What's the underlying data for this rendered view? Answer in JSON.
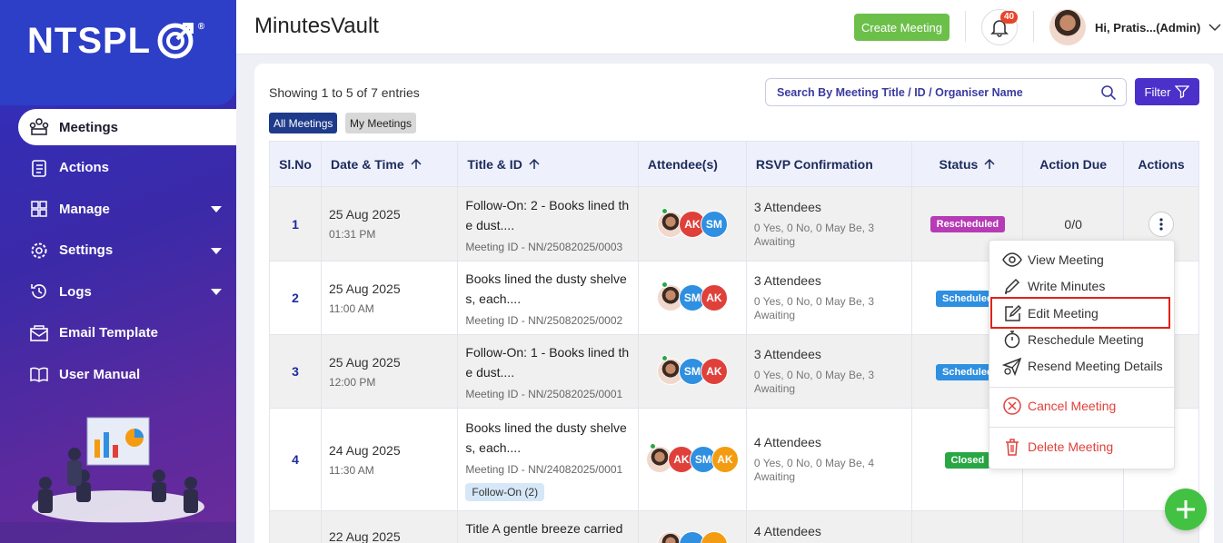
{
  "brand": {
    "logo_text": "NTSPL",
    "reg": "®"
  },
  "sidebar": {
    "items": [
      {
        "label": "Meetings",
        "icon": "meetings-icon",
        "active": true
      },
      {
        "label": "Actions",
        "icon": "clipboard-icon"
      },
      {
        "label": "Manage",
        "icon": "grid-icon",
        "has_caret": true
      },
      {
        "label": "Settings",
        "icon": "gear-icon",
        "has_caret": true
      },
      {
        "label": "Logs",
        "icon": "history-icon",
        "has_caret": true
      },
      {
        "label": "Email Template",
        "icon": "email-icon"
      },
      {
        "label": "User Manual",
        "icon": "book-icon"
      }
    ]
  },
  "header": {
    "title": "MinutesVault",
    "create_label": "Create Meeting",
    "notification_count": "40",
    "user_name": "Hi, Pratis...(Admin)"
  },
  "toolbar": {
    "showing": "Showing 1 to 5 of 7 entries",
    "search_placeholder": "Search By Meeting Title / ID / Organiser Name",
    "filter_label": "Filter",
    "chip_all": "All Meetings",
    "chip_my": "My Meetings"
  },
  "table": {
    "headers": [
      "Sl.No",
      "Date & Time",
      "Title & ID",
      "Attendee(s)",
      "RSVP Confirmation",
      "Status",
      "Action Due",
      "Actions"
    ],
    "rows": [
      {
        "sl": "1",
        "date": "25 Aug 2025",
        "time": "01:31 PM",
        "title_1": "Follow-On: 2 - Books lined th",
        "title_2": "e dust....",
        "mid": "Meeting ID - NN/25082025/0003",
        "attendees": [
          "AK",
          "SM"
        ],
        "rsvp_1": "3 Attendees",
        "rsvp_2": "0 Yes, 0 No, 0 May Be, 3",
        "rsvp_3": "Awaiting",
        "status": "Rescheduled",
        "due": "0/0"
      },
      {
        "sl": "2",
        "date": "25 Aug 2025",
        "time": "11:00 AM",
        "title_1": "Books lined the dusty shelve",
        "title_2": "s, each....",
        "mid": "Meeting ID - NN/25082025/0002",
        "attendees": [
          "SM",
          "AK"
        ],
        "rsvp_1": "3 Attendees",
        "rsvp_2": "0 Yes, 0 No, 0 May Be, 3",
        "rsvp_3": "Awaiting",
        "status": "Scheduled",
        "due": ""
      },
      {
        "sl": "3",
        "date": "25 Aug 2025",
        "time": "12:00 PM",
        "title_1": "Follow-On: 1 - Books lined th",
        "title_2": "e dust....",
        "mid": "Meeting ID - NN/25082025/0001",
        "attendees": [
          "SM",
          "AK"
        ],
        "rsvp_1": "3 Attendees",
        "rsvp_2": "0 Yes, 0 No, 0 May Be, 3",
        "rsvp_3": "Awaiting",
        "status": "Scheduled",
        "due": ""
      },
      {
        "sl": "4",
        "date": "24 Aug 2025",
        "time": "11:30 AM",
        "title_1": "Books lined the dusty shelve",
        "title_2": "s, each....",
        "mid": "Meeting ID - NN/24082025/0001",
        "follow_on": "Follow-On (2)",
        "attendees": [
          "AK",
          "SM",
          "AK"
        ],
        "rsvp_1": "4 Attendees",
        "rsvp_2": "0 Yes, 0 No, 0 May Be, 4",
        "rsvp_3": "Awaiting",
        "status": "Closed",
        "due": ""
      },
      {
        "sl": "",
        "date": "22 Aug 2025",
        "time": "",
        "title_1": "Title A gentle breeze carried",
        "title_2": "",
        "mid": "",
        "attendees": [],
        "rsvp_1": "4 Attendees",
        "rsvp_2": "",
        "rsvp_3": "",
        "status": "",
        "due": ""
      }
    ]
  },
  "menu": {
    "view": "View Meeting",
    "write": "Write Minutes",
    "edit": "Edit Meeting",
    "reschedule": "Reschedule Meeting",
    "resend": "Resend Meeting Details",
    "cancel": "Cancel Meeting",
    "delete": "Delete Meeting"
  },
  "colors": {
    "primary": "#4b31c9",
    "create": "#6cc04a",
    "rescheduled": "#b63bb5",
    "scheduled": "#2f8fe0",
    "closed": "#29a745",
    "danger": "#e0403a"
  }
}
